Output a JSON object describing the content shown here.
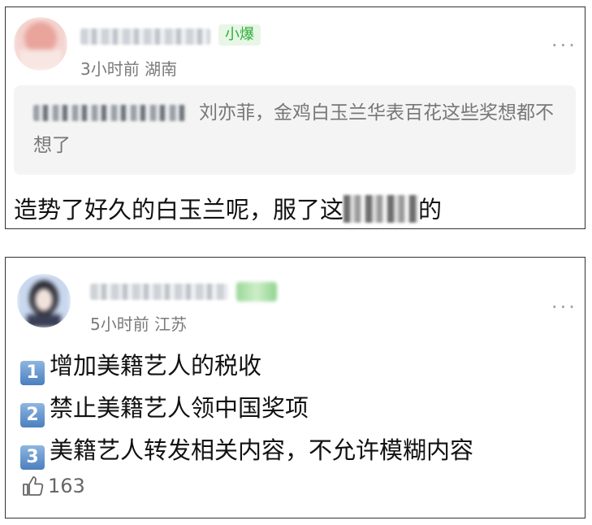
{
  "comment1": {
    "badge": "小爆",
    "time": "3小时前",
    "location": "湖南",
    "quote_text": "刘亦菲，金鸡白玉兰华表百花这些奖想都不想了",
    "body_before": "造势了好久的白玉兰呢，服了这",
    "body_after": "的",
    "more": "···"
  },
  "comment2": {
    "time": "5小时前",
    "location": "江苏",
    "items": [
      {
        "num": "1",
        "text": "增加美籍艺人的税收"
      },
      {
        "num": "2",
        "text": "禁止美籍艺人领中国奖项"
      },
      {
        "num": "3",
        "text": "美籍艺人转发相关内容，不允许模糊内容"
      }
    ],
    "likes": "163",
    "more": "···"
  },
  "colors": {
    "badge_green": "#2fae38",
    "meta_gray": "#7a7a7a",
    "quote_bg": "#f4f4f4"
  },
  "icons": [
    "avatar-blurred",
    "more-dots-icon",
    "thumbs-up-icon",
    "keycap-number-icon"
  ]
}
